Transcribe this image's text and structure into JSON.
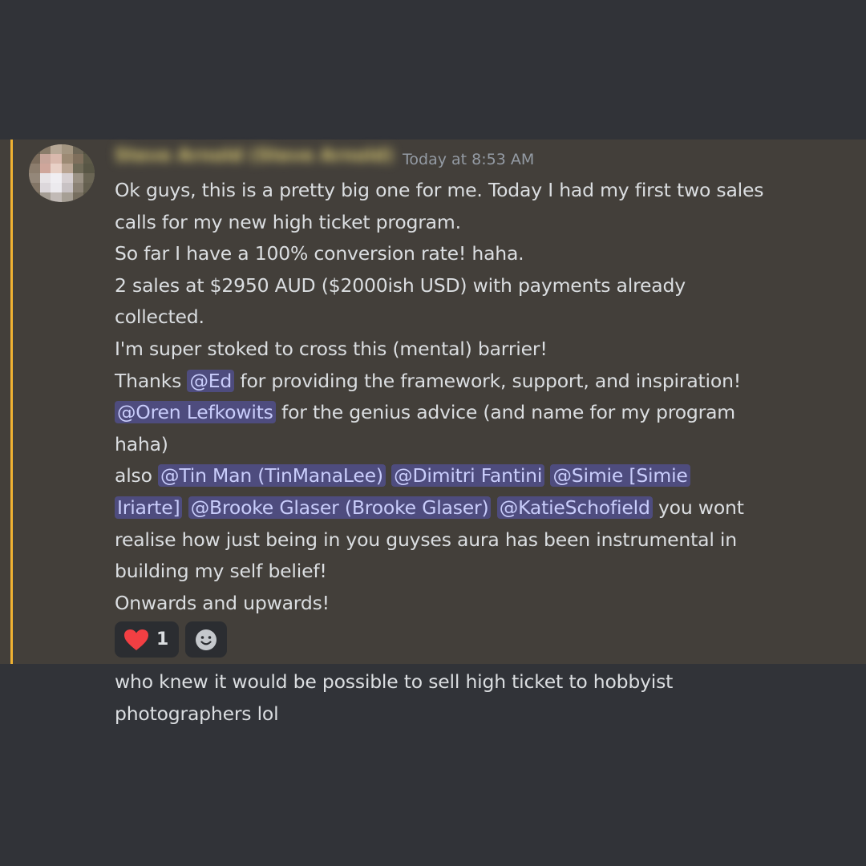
{
  "message": {
    "author": "Steve Arnold (Steve Arnold)",
    "timestamp": "Today at 8:53 AM",
    "lines": [
      [
        {
          "t": "Ok guys, this is a pretty big one for me. Today I had my first two sales"
        }
      ],
      [
        {
          "t": "calls for my new high ticket program."
        }
      ],
      [
        {
          "t": "So far I have a 100% conversion rate! haha."
        }
      ],
      [
        {
          "t": "2 sales at $2950 AUD ($2000ish USD) with payments already"
        }
      ],
      [
        {
          "t": "collected."
        }
      ],
      [
        {
          "t": "I'm super stoked to cross this (mental) barrier!"
        }
      ],
      [
        {
          "t": "Thanks "
        },
        {
          "t": "@Ed",
          "m": true
        },
        {
          "t": " for providing the framework, support, and inspiration!"
        }
      ],
      [
        {
          "t": "@Oren Lefkowits",
          "m": true
        },
        {
          "t": " for the genius advice (and name for my program"
        }
      ],
      [
        {
          "t": "haha)"
        }
      ],
      [
        {
          "t": "also "
        },
        {
          "t": "@Tin Man (TinManaLee)",
          "m": true
        },
        {
          "t": " "
        },
        {
          "t": "@Dimitri Fantini",
          "m": true
        },
        {
          "t": " "
        },
        {
          "t": "@Simie [Simie",
          "m": true
        }
      ],
      [
        {
          "t": "Iriarte]",
          "m": true
        },
        {
          "t": " "
        },
        {
          "t": "@Brooke Glaser (Brooke Glaser)",
          "m": true
        },
        {
          "t": " "
        },
        {
          "t": "@KatieSchofield",
          "m": true
        },
        {
          "t": " you wont"
        }
      ],
      [
        {
          "t": "realise how just being in you guyses aura has been instrumental in"
        }
      ],
      [
        {
          "t": "building my self belief!"
        }
      ],
      [
        {
          "t": "Onwards and upwards!"
        }
      ]
    ],
    "reactions": [
      {
        "icon": "heart-icon",
        "count": "1"
      },
      {
        "icon": "add-reaction-icon"
      }
    ]
  },
  "next_message": {
    "lines": [
      "who knew it would be possible to sell high ticket to hobbyist",
      "photographers lol"
    ]
  },
  "colors": {
    "background": "#313338",
    "highlight_background": "#433f3a",
    "highlight_bar": "#f0b232",
    "mention_background": "#4e4c7e",
    "mention_text": "#c9cdfb",
    "heart": "#f23f43"
  }
}
